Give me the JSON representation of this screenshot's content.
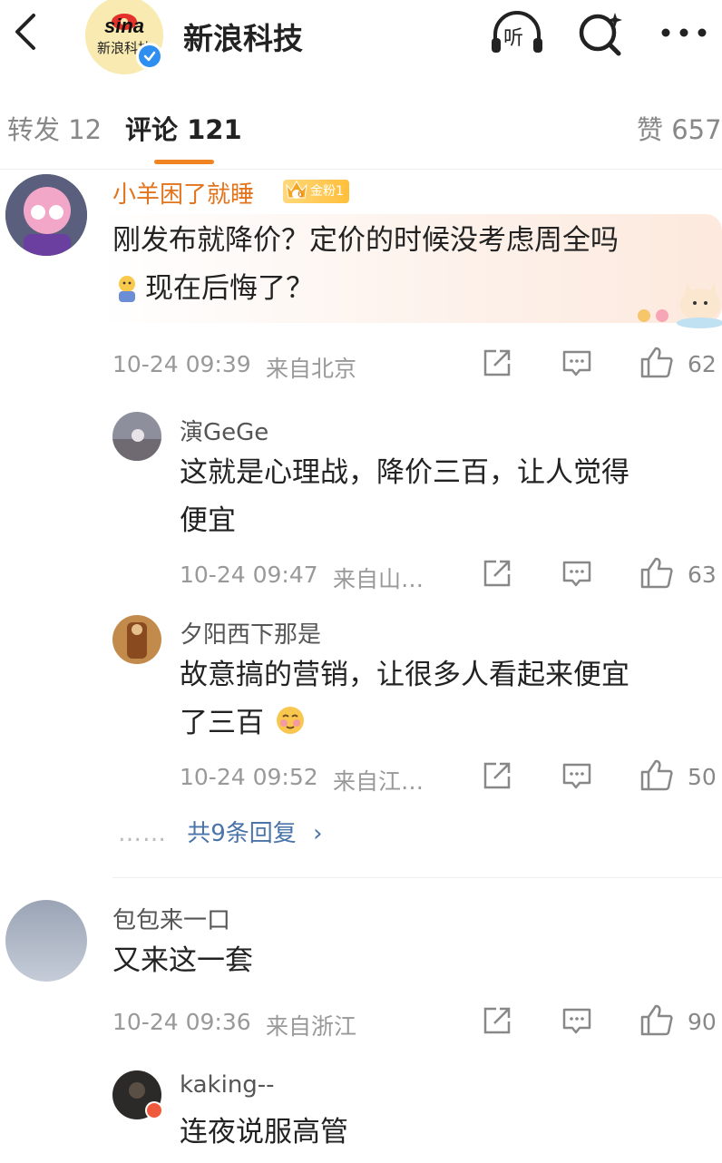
{
  "header": {
    "account_name": "新浪科技",
    "logo_text": "sina",
    "logo_sub": "新浪科技",
    "listen_label": "听"
  },
  "tabs": {
    "repost": "转发 12",
    "comments": "评论 121",
    "likes": "赞 657"
  },
  "comments": [
    {
      "user": "小羊困了就睡",
      "badge": "金粉1",
      "badge_level": "6",
      "lines": [
        "刚发布就降价？定价的时候没考虑周全吗",
        "现在后悔了？"
      ],
      "time": "10-24 09:39",
      "location": "来自北京",
      "likes": "62"
    },
    {
      "user": "包包来一口",
      "lines": [
        "又来这一套"
      ],
      "time": "10-24 09:36",
      "location": "来自浙江",
      "likes": "90"
    }
  ],
  "replies": [
    {
      "user": "演GeGe",
      "lines": [
        "这就是心理战，降价三百，让人觉得",
        "便宜"
      ],
      "time": "10-24 09:47",
      "location": "来自山…",
      "likes": "63"
    },
    {
      "user": "夕阳西下那是",
      "lines": [
        "故意搞的营销，让很多人看起来便宜",
        "了三百"
      ],
      "time": "10-24 09:52",
      "location": "来自江…",
      "likes": "50"
    },
    {
      "user": "kaking--",
      "lines": [
        "连夜说服高管"
      ]
    }
  ],
  "more_replies": {
    "dots": "……",
    "label": "共9条回复",
    "chevron": "›"
  },
  "icons": {
    "back": "back-arrow-icon",
    "listen": "headphones-icon",
    "search": "search-sparkle-icon",
    "more": "more-dots-icon",
    "repost": "repost-icon",
    "comment": "comment-icon",
    "like": "thumbs-up-icon"
  },
  "colors": {
    "accent": "#f08422",
    "vip_name": "#e2741d",
    "link": "#4a74a8",
    "verified": "#2f8ff0"
  }
}
